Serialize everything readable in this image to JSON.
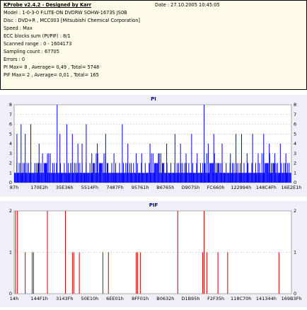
{
  "info": {
    "app_title": "KProbe v2.4.2 - Designed by Karr",
    "date": "Date : 27.10.2005 10:45:05",
    "lines": [
      "Model : 1-0-3-0 F:LITE-ON DVDRW SOHW-1673S JS0B",
      "Disc : DVD+R , MCC003 [Mitsubishi Chemical Corporation]",
      "Speed : Max",
      "ECC blocks sum (PI/PIF) : 8/1",
      "Scanned range : 0 - 1604173",
      "Sampling count : 67705",
      "Errors : 0",
      "PI Max= 8 , Average= 0,49 , Total= 5748",
      "PIF Max= 2 , Average= 0,01 , Total= 165"
    ]
  },
  "colors": {
    "pi_line": "#0000ff",
    "pif_line": "#cc0000",
    "panel_bg": "#efeff7",
    "title": "#000080"
  },
  "chart_data": [
    {
      "type": "bar",
      "title": "PI",
      "ylim": [
        0,
        8
      ],
      "yticks": [
        0,
        1,
        2,
        3,
        4,
        5,
        6,
        7,
        8
      ],
      "x_tick_labels": [
        "87h",
        "170E2h",
        "35E36h",
        "5514Fh",
        "7487Fh",
        "95761h",
        "B6765h",
        "D907Sh",
        "FC660h",
        "122994h",
        "148C4Fh",
        "16E2E1h"
      ],
      "baseline": 1,
      "spikes": [
        [
          0.01,
          5
        ],
        [
          0.025,
          6
        ],
        [
          0.04,
          5
        ],
        [
          0.06,
          6
        ],
        [
          0.09,
          4
        ],
        [
          0.12,
          3
        ],
        [
          0.155,
          8
        ],
        [
          0.165,
          5
        ],
        [
          0.19,
          6
        ],
        [
          0.21,
          5
        ],
        [
          0.23,
          4
        ],
        [
          0.245,
          4
        ],
        [
          0.26,
          6
        ],
        [
          0.28,
          3
        ],
        [
          0.3,
          4
        ],
        [
          0.33,
          5
        ],
        [
          0.36,
          3
        ],
        [
          0.39,
          6
        ],
        [
          0.41,
          4
        ],
        [
          0.44,
          3
        ],
        [
          0.46,
          3
        ],
        [
          0.49,
          4
        ],
        [
          0.52,
          3
        ],
        [
          0.55,
          4
        ],
        [
          0.58,
          5
        ],
        [
          0.6,
          4
        ],
        [
          0.62,
          3
        ],
        [
          0.64,
          5
        ],
        [
          0.66,
          3
        ],
        [
          0.685,
          8
        ],
        [
          0.7,
          4
        ],
        [
          0.72,
          5
        ],
        [
          0.75,
          4
        ],
        [
          0.78,
          3
        ],
        [
          0.8,
          5
        ],
        [
          0.82,
          5
        ],
        [
          0.84,
          3
        ],
        [
          0.86,
          5
        ],
        [
          0.88,
          3
        ],
        [
          0.9,
          5
        ],
        [
          0.92,
          4
        ],
        [
          0.94,
          3
        ],
        [
          0.96,
          4
        ],
        [
          0.98,
          3
        ]
      ]
    },
    {
      "type": "bar",
      "title": "PIF",
      "ylim": [
        0,
        2
      ],
      "yticks": [
        0,
        1,
        2
      ],
      "x_tick_labels": [
        "14h",
        "144F1h",
        "3143Fh",
        "50E10h",
        "6EE01h",
        "8FF01h",
        "B0632h",
        "D1B95h",
        "F2F35h",
        "118C70h",
        "141344h",
        "169B3Fh"
      ],
      "spikes": [
        [
          0.005,
          2
        ],
        [
          0.012,
          2
        ],
        [
          0.04,
          1
        ],
        [
          0.065,
          1
        ],
        [
          0.07,
          1
        ],
        [
          0.12,
          2
        ],
        [
          0.185,
          2
        ],
        [
          0.21,
          1
        ],
        [
          0.215,
          1
        ],
        [
          0.235,
          1
        ],
        [
          0.32,
          1
        ],
        [
          0.34,
          1
        ],
        [
          0.44,
          1
        ],
        [
          0.445,
          1
        ],
        [
          0.455,
          1
        ],
        [
          0.59,
          2
        ],
        [
          0.68,
          1
        ],
        [
          0.685,
          2
        ],
        [
          0.695,
          1
        ],
        [
          0.735,
          1
        ],
        [
          0.77,
          1
        ],
        [
          0.955,
          1
        ]
      ]
    }
  ]
}
